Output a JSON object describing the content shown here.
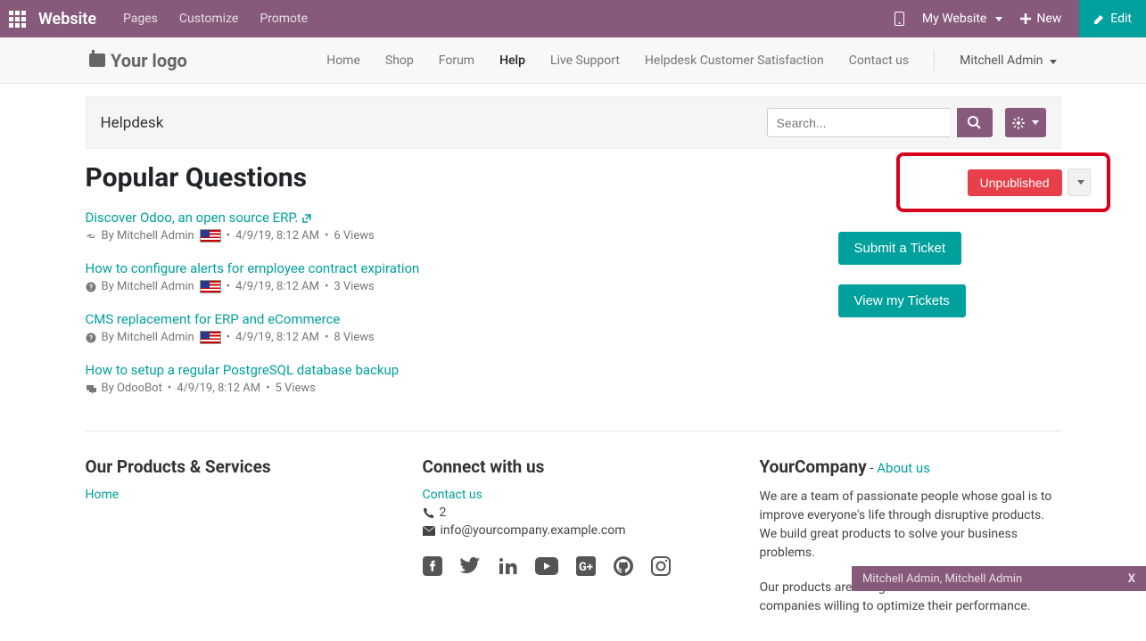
{
  "topbar": {
    "brand": "Website",
    "menu": [
      "Pages",
      "Customize",
      "Promote"
    ],
    "my_website": "My Website",
    "new_label": "New",
    "edit_label": "Edit"
  },
  "subnav": {
    "logo_text": "Your logo",
    "links": [
      "Home",
      "Shop",
      "Forum",
      "Help",
      "Live Support",
      "Helpdesk Customer Satisfaction",
      "Contact us"
    ],
    "active_index": 3,
    "user": "Mitchell Admin"
  },
  "searchrow": {
    "title": "Helpdesk",
    "placeholder": "Search..."
  },
  "unpublished_label": "Unpublished",
  "popular_heading": "Popular Questions",
  "right_col": {
    "submit_label": "Submit a Ticket",
    "view_label": "View my Tickets"
  },
  "questions": [
    {
      "title": "Discover Odoo, an open source ERP.",
      "has_ext": true,
      "icon": "link",
      "author": "By Mitchell Admin",
      "has_flag": true,
      "date": "4/9/19, 8:12 AM",
      "views": "6 Views"
    },
    {
      "title": "How to configure alerts for employee contract expiration",
      "has_ext": false,
      "icon": "question",
      "author": "By Mitchell Admin",
      "has_flag": true,
      "date": "4/9/19, 8:12 AM",
      "views": "3 Views"
    },
    {
      "title": "CMS replacement for ERP and eCommerce",
      "has_ext": false,
      "icon": "question",
      "author": "By Mitchell Admin",
      "has_flag": true,
      "date": "4/9/19, 8:12 AM",
      "views": "8 Views"
    },
    {
      "title": "How to setup a regular PostgreSQL database backup",
      "has_ext": false,
      "icon": "chat",
      "author": "By OdooBot",
      "has_flag": false,
      "date": "4/9/19, 8:12 AM",
      "views": "5 Views"
    }
  ],
  "footer": {
    "col1_heading": "Our Products & Services",
    "col1_link": "Home",
    "col2_heading": "Connect with us",
    "col2_contact": "Contact us",
    "col2_phone": "2",
    "col2_email": "info@yourcompany.example.com",
    "col3_company": "YourCompany",
    "col3_about_dash": " - ",
    "col3_about": "About us",
    "col3_p1": "We are a team of passionate people whose goal is to improve everyone's life through disruptive products. We build great products to solve your business problems.",
    "col3_p2": "Our products are designed for small to medium size companies willing to optimize their performance."
  },
  "chat": {
    "title": "Mitchell Admin, Mitchell Admin",
    "close": "X"
  }
}
